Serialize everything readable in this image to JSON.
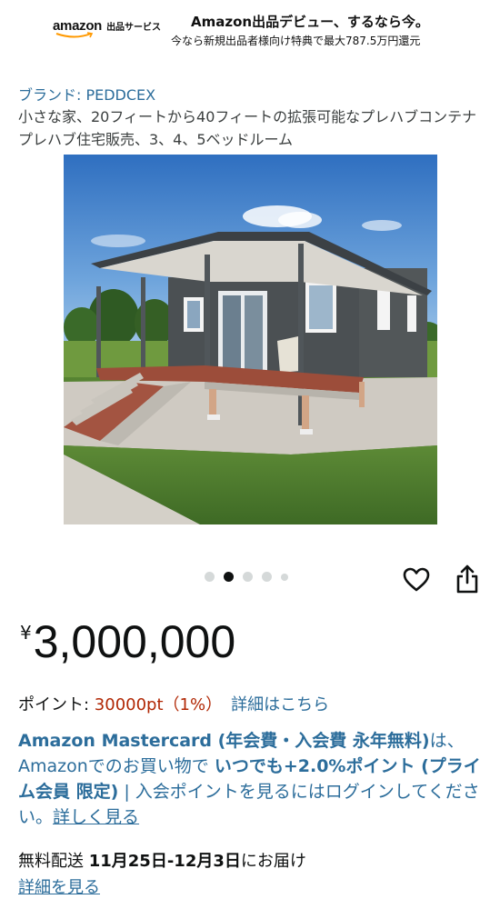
{
  "banner": {
    "logo_word": "amazon",
    "logo_service": "出品サービス",
    "headline": "Amazon出品デビュー、するなら今。",
    "subline": "今なら新規出品者様向け特典で最大787.5万円還元"
  },
  "product": {
    "brand": "ブランド: PEDDCEX",
    "title": "小さな家、20フィートから40フィートの拡張可能なプレハブコンテナプレハブ住宅販売、3、4、5ベッドルーム"
  },
  "gallery": {
    "image_alt": "prefab-container-house-photo",
    "dots": 5,
    "active_index": 1
  },
  "actions": {
    "favorite_icon": "heart-icon",
    "share_icon": "share-icon"
  },
  "pricing": {
    "currency": "¥",
    "amount": "3,000,000",
    "points_label": "ポイント: ",
    "points_value": "30000pt（1%）",
    "points_link": "詳細はこちら"
  },
  "card_offer": {
    "bold_head": "Amazon Mastercard (年会費・入会費 永年無料)",
    "middle": "は、Amazonでのお買い物で ",
    "bold_points": "いつでも+2.0%ポイント (プライム会員 限定)",
    "tail": " | 入会ポイントを見るにはログインしてください。",
    "link": "詳しく見る"
  },
  "shipping": {
    "prefix": "無料配送 ",
    "dates": "11月25日-12月3日",
    "suffix": "にお届け",
    "link": "詳細を見る"
  },
  "colors": {
    "link": "#2c6d9b",
    "price_red": "#b12704",
    "text": "#0f1111"
  }
}
